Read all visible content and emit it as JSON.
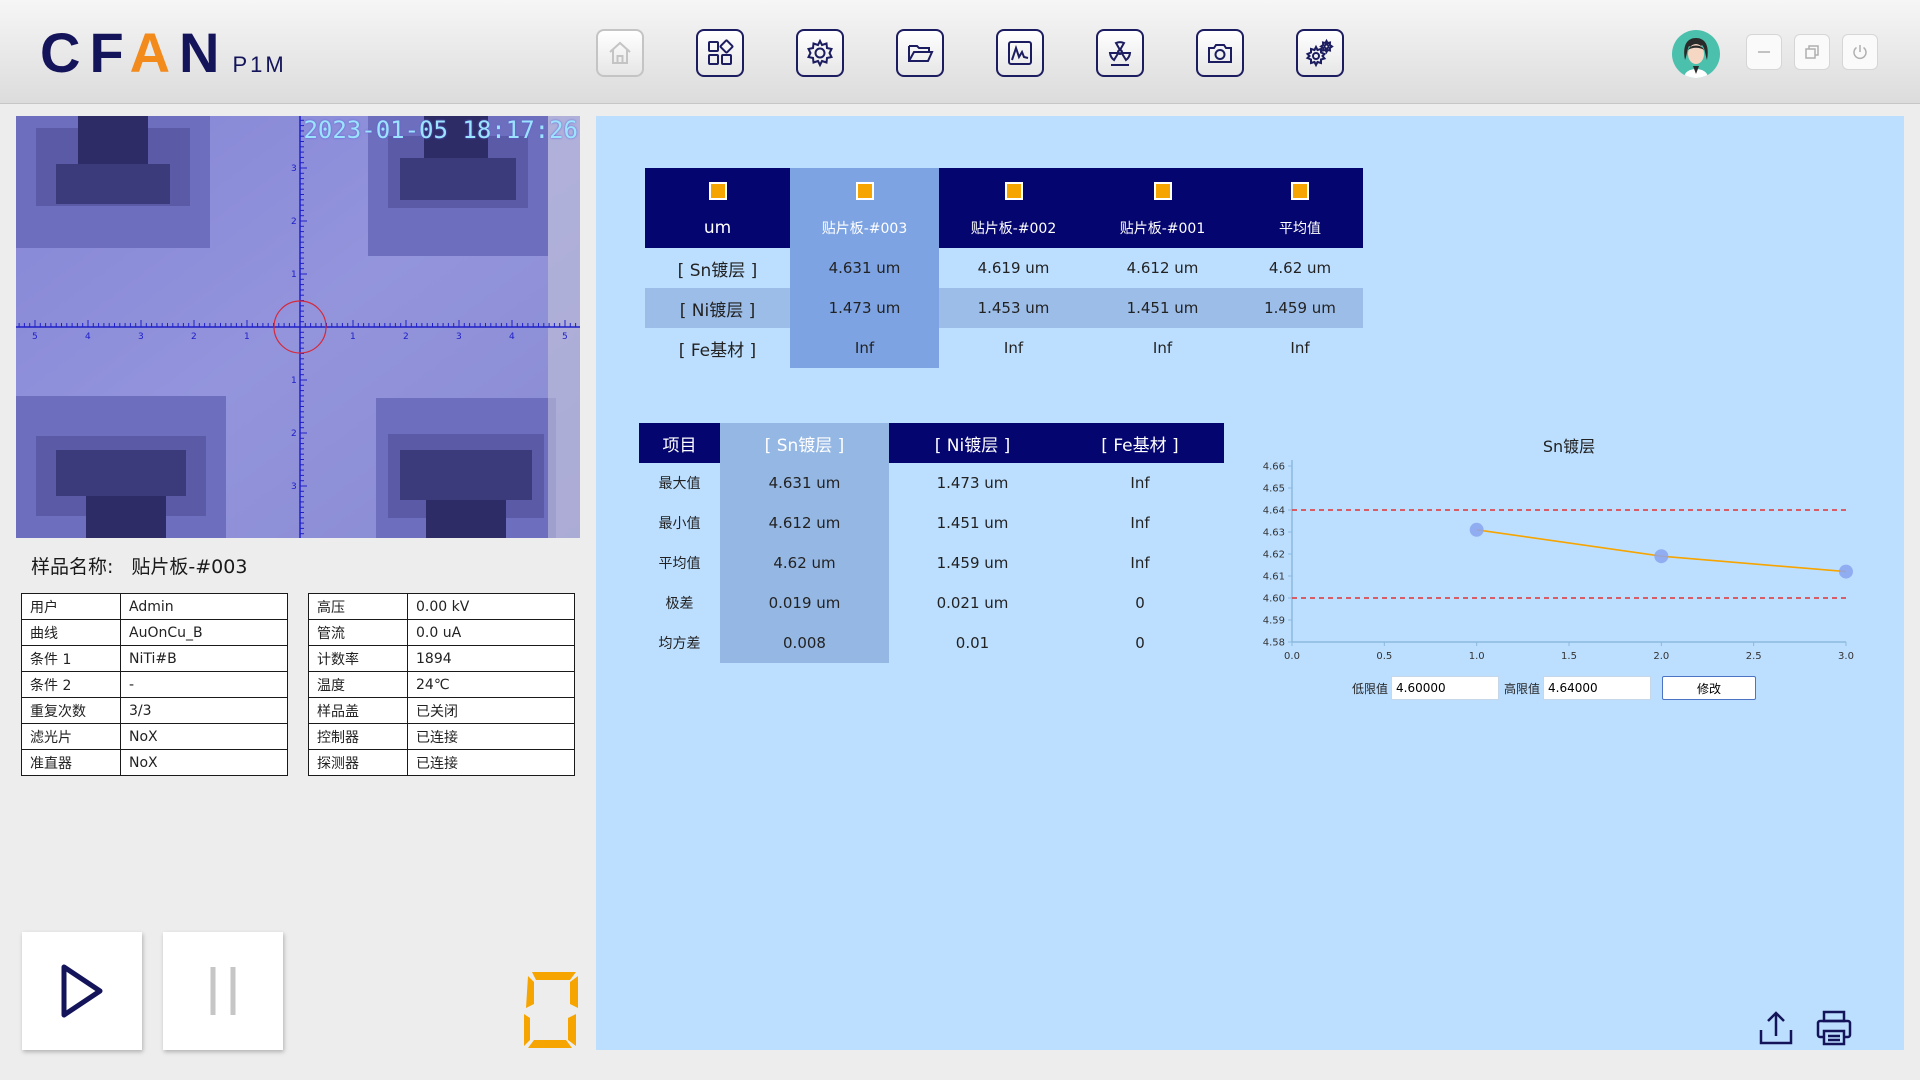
{
  "header": {
    "logo_main_a": "CF",
    "logo_main_b": "A",
    "logo_main_c": "N",
    "logo_sub": "P1M",
    "brand_color": "#14145a",
    "accent_color": "#f28a1c",
    "toolbar": [
      {
        "icon": "home-icon",
        "enabled": false
      },
      {
        "icon": "apps-icon",
        "enabled": true
      },
      {
        "icon": "settings-icon",
        "enabled": true
      },
      {
        "icon": "folder-icon",
        "enabled": true
      },
      {
        "icon": "chart-icon",
        "enabled": true
      },
      {
        "icon": "radiation-icon",
        "enabled": true
      },
      {
        "icon": "camera-icon",
        "enabled": true
      },
      {
        "icon": "advanced-settings-icon",
        "enabled": true
      }
    ]
  },
  "camera": {
    "timestamp": "2023-01-05 18:17:26",
    "x_ticks": [
      "5",
      "4",
      "3",
      "2",
      "1",
      "1",
      "2",
      "3",
      "4",
      "5"
    ],
    "y_ticks": [
      "3",
      "2",
      "1",
      "1",
      "2",
      "3"
    ]
  },
  "sample": {
    "label": "样品名称:",
    "value": "贴片板-#003"
  },
  "info_left": [
    {
      "k": "用户",
      "v": "Admin"
    },
    {
      "k": "曲线",
      "v": "AuOnCu_B"
    },
    {
      "k": "条件 1",
      "v": "NiTi#B"
    },
    {
      "k": "条件 2",
      "v": "-"
    },
    {
      "k": "重复次数",
      "v": "3/3"
    },
    {
      "k": "滤光片",
      "v": "NoX"
    },
    {
      "k": "准直器",
      "v": "NoX"
    }
  ],
  "info_right": [
    {
      "k": "高压",
      "v": "0.00 kV"
    },
    {
      "k": "管流",
      "v": "0.0 uA"
    },
    {
      "k": "计数率",
      "v": "1894"
    },
    {
      "k": "温度",
      "v": "24℃"
    },
    {
      "k": "样品盖",
      "v": "已关闭"
    },
    {
      "k": "控制器",
      "v": "已连接"
    },
    {
      "k": "探测器",
      "v": "已连接"
    }
  ],
  "counter_digit": "0",
  "results": {
    "unit": "um",
    "columns": [
      "贴片板-#003",
      "贴片板-#002",
      "贴片板-#001",
      "平均值"
    ],
    "rows": [
      {
        "label": "[ Sn镀层 ]",
        "values": [
          "4.631 um",
          "4.619 um",
          "4.612 um",
          "4.62 um"
        ]
      },
      {
        "label": "[ Ni镀层 ]",
        "values": [
          "1.473 um",
          "1.453 um",
          "1.451 um",
          "1.459 um"
        ]
      },
      {
        "label": "[ Fe基材 ]",
        "values": [
          "Inf",
          "Inf",
          "Inf",
          "Inf"
        ]
      }
    ]
  },
  "stats": {
    "header": [
      "项目",
      "[ Sn镀层 ]",
      "[ Ni镀层 ]",
      "[ Fe基材 ]"
    ],
    "rows": [
      {
        "label": "最大值",
        "values": [
          "4.631 um",
          "1.473 um",
          "Inf"
        ]
      },
      {
        "label": "最小值",
        "values": [
          "4.612 um",
          "1.451 um",
          "Inf"
        ]
      },
      {
        "label": "平均值",
        "values": [
          "4.62 um",
          "1.459 um",
          "Inf"
        ]
      },
      {
        "label": "极差",
        "values": [
          "0.019 um",
          "0.021 um",
          "0"
        ]
      },
      {
        "label": "均方差",
        "values": [
          "0.008",
          "0.01",
          "0"
        ]
      }
    ]
  },
  "chart_data": {
    "type": "line",
    "title": "Sn镀层",
    "x": [
      1.0,
      2.0,
      3.0
    ],
    "series": [
      {
        "values": [
          4.631,
          4.619,
          4.612
        ]
      }
    ],
    "xlim": [
      0.0,
      3.0
    ],
    "ylim": [
      4.58,
      4.66
    ],
    "x_ticks": [
      "0.0",
      "0.5",
      "1.0",
      "1.5",
      "2.0",
      "2.5",
      "3.0"
    ],
    "y_ticks": [
      "4.58",
      "4.59",
      "4.60",
      "4.61",
      "4.62",
      "4.63",
      "4.64",
      "4.65",
      "4.66"
    ],
    "lower_limit": 4.6,
    "upper_limit": 4.64,
    "line_color": "#f6a400",
    "marker_color": "#8aa4f0",
    "limit_color": "#e03434",
    "grid": false
  },
  "limits": {
    "low_label": "低限值",
    "low_value": "4.60000",
    "high_label": "高限值",
    "high_value": "4.64000",
    "modify_label": "修改"
  }
}
